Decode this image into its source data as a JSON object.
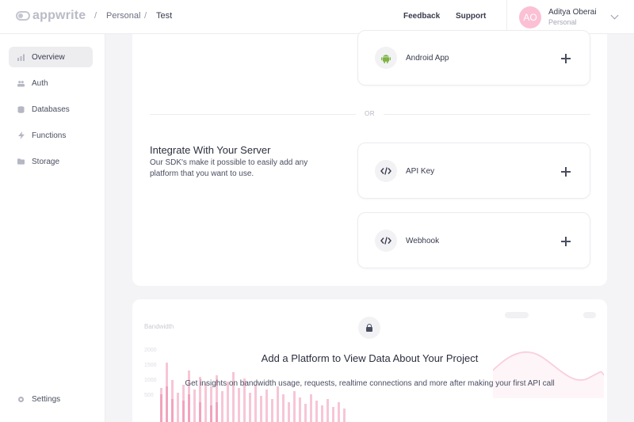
{
  "header": {
    "logo_text": "appwrite",
    "breadcrumb": {
      "sep": "/",
      "org": "Personal",
      "project": "Test"
    },
    "feedback": "Feedback",
    "support": "Support",
    "user": {
      "initials": "AO",
      "name": "Aditya Oberai",
      "org": "Personal"
    }
  },
  "sidebar": {
    "items": [
      {
        "label": "Overview",
        "icon": "chart-icon"
      },
      {
        "label": "Auth",
        "icon": "users-icon"
      },
      {
        "label": "Databases",
        "icon": "database-icon"
      },
      {
        "label": "Functions",
        "icon": "lightning-icon"
      },
      {
        "label": "Storage",
        "icon": "folder-icon"
      }
    ],
    "settings": "Settings"
  },
  "platforms": {
    "android": "Android App",
    "or": "OR",
    "server_title": "Integrate With Your Server",
    "server_desc": "Our SDK's make it possible to easily add any platform that you want to use.",
    "api_key": "API Key",
    "webhook": "Webhook"
  },
  "empty_state": {
    "bandwidth_label": "Bandwidth",
    "y_ticks": [
      "2000",
      "1500",
      "1000",
      "500"
    ],
    "title": "Add a Platform to View Data About Your Project",
    "description": "Get insights on bandwidth usage, requests, realtime connections and more after making your first API call"
  },
  "colors": {
    "accent": "#f02e65",
    "avatar": "#fbc0d4",
    "android": "#7cb342"
  }
}
